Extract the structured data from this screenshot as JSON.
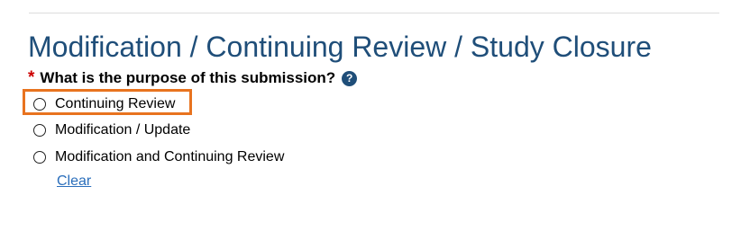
{
  "page": {
    "title": "Modification / Continuing Review / Study Closure"
  },
  "question": {
    "required_marker": "*",
    "text": "What is the purpose of this submission?",
    "help_icon": "help-circle-icon",
    "help_glyph": "?"
  },
  "options": [
    {
      "label": "Continuing Review",
      "selected": false,
      "highlighted": true
    },
    {
      "label": "Modification / Update",
      "selected": false,
      "highlighted": false
    },
    {
      "label": "Modification and Continuing Review",
      "selected": false,
      "highlighted": false
    }
  ],
  "clear_link": "Clear",
  "colors": {
    "title": "#1f4e79",
    "required": "#cc0000",
    "highlight": "#e8731f",
    "link": "#2a6ebb"
  }
}
